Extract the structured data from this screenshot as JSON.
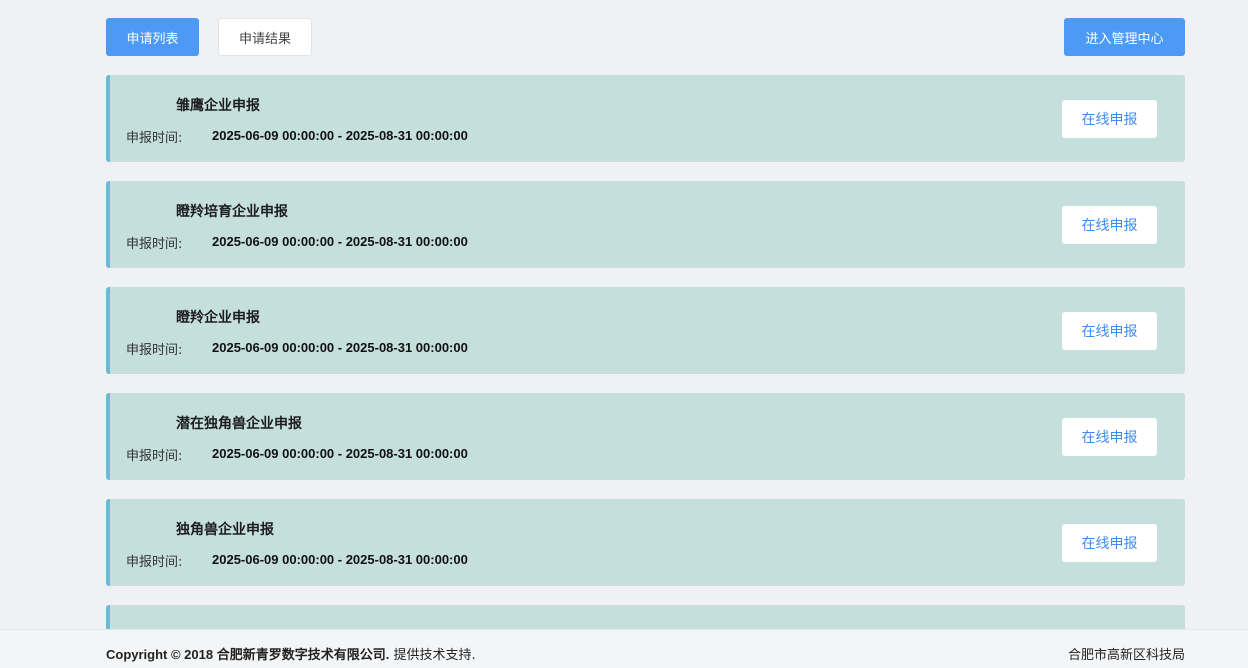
{
  "header": {
    "tab_list_label": "申请列表",
    "tab_result_label": "申请结果",
    "admin_label": "进入管理中心"
  },
  "time_label": "申报时间:",
  "apply_label": "在线申报",
  "items": [
    {
      "title": "雏鹰企业申报",
      "time": "2025-06-09 00:00:00 - 2025-08-31 00:00:00"
    },
    {
      "title": "瞪羚培育企业申报",
      "time": "2025-06-09 00:00:00 - 2025-08-31 00:00:00"
    },
    {
      "title": "瞪羚企业申报",
      "time": "2025-06-09 00:00:00 - 2025-08-31 00:00:00"
    },
    {
      "title": "潜在独角兽企业申报",
      "time": "2025-06-09 00:00:00 - 2025-08-31 00:00:00"
    },
    {
      "title": "独角兽企业申报",
      "time": "2025-06-09 00:00:00 - 2025-08-31 00:00:00"
    }
  ],
  "footer": {
    "copyright_main": "Copyright © 2018 合肥新青罗数字技术有限公司.",
    "copyright_tail": " 提供技术支持.",
    "bureau": "合肥市高新区科技局"
  },
  "colors": {
    "accent": "#4d9af5",
    "card_bg": "#c4dfdc",
    "card_border": "#6bbbd5",
    "link": "#3f8bf0"
  }
}
